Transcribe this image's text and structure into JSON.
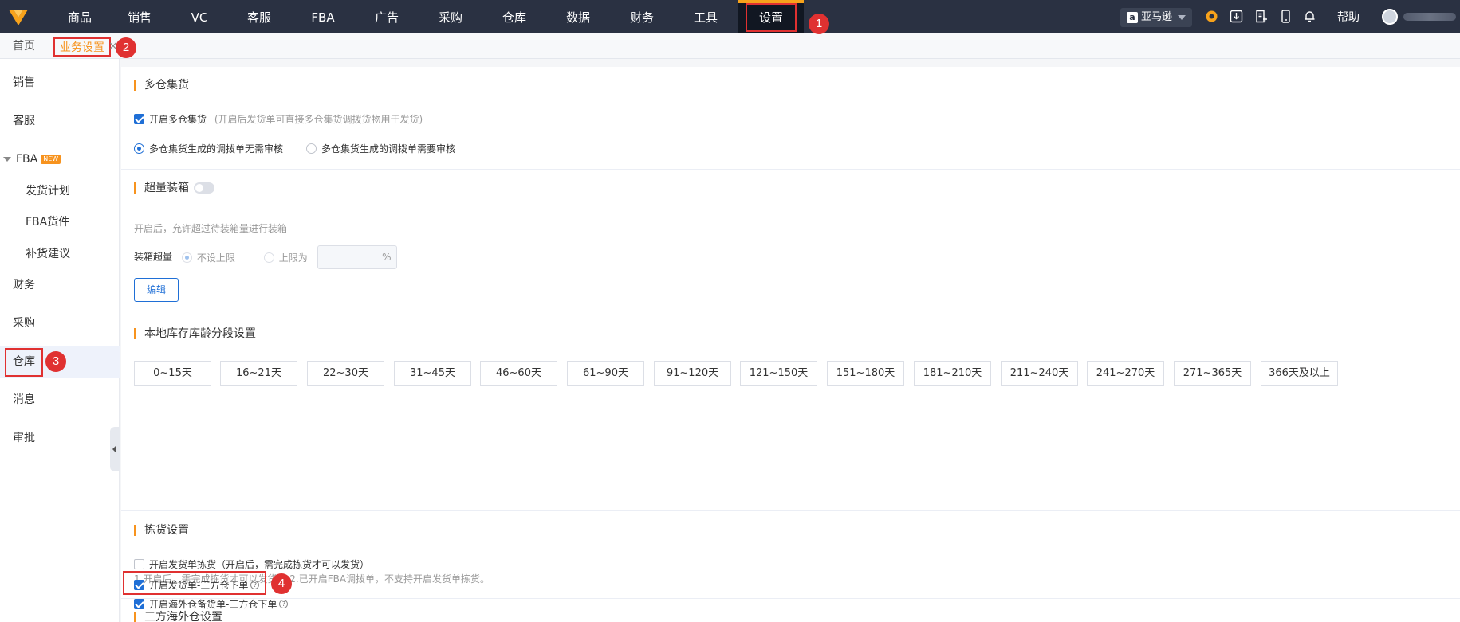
{
  "topnav": {
    "items": [
      "商品",
      "销售",
      "VC",
      "客服",
      "FBA",
      "广告",
      "采购",
      "仓库",
      "数据",
      "财务",
      "工具",
      "设置"
    ],
    "active": "设置",
    "market": "亚马逊",
    "help": "帮助"
  },
  "tabs": {
    "home": "首页",
    "active": "业务设置",
    "close": "×"
  },
  "sidebar": {
    "items": [
      "销售",
      "客服",
      "FBA",
      "发货计划",
      "FBA货件",
      "补货建议",
      "财务",
      "采购",
      "仓库",
      "消息",
      "审批"
    ],
    "new_badge": "NEW",
    "selected": "仓库"
  },
  "sections": {
    "multi_warehouse": {
      "title": "多仓集货",
      "enable_label": "开启多仓集货",
      "enable_hint": "(开启后发货单可直接多仓集货调拨货物用于发货)",
      "enabled": true,
      "radio_no_review": "多仓集货生成的调拨单无需审核",
      "radio_need_review": "多仓集货生成的调拨单需要审核",
      "selected": "no_review"
    },
    "overpack": {
      "title": "超量装箱",
      "toggle_on": false,
      "desc": "开启后，允许超过待装箱量进行装箱",
      "field_label": "装箱超量",
      "opt_unlimited": "不设上限",
      "opt_limit": "上限为",
      "unit": "%",
      "edit_label": "编辑"
    },
    "inventory_age": {
      "title": "本地库存库龄分段设置",
      "ranges": [
        "0~15天",
        "16~21天",
        "22~30天",
        "31~45天",
        "46~60天",
        "61~90天",
        "91~120天",
        "121~150天",
        "151~180天",
        "181~210天",
        "211~240天",
        "241~270天",
        "271~365天",
        "366天及以上"
      ]
    },
    "picking": {
      "title": "拣货设置",
      "enable_label": "开启发货单拣货（开启后，需完成拣货才可以发货）",
      "enabled": false,
      "hint": "1.开启后，需完成拣货才可以发货。 2.已开启FBA调拨单，不支持开启发货单拣货。"
    },
    "third_party": {
      "title": "三方海外仓设置",
      "opt1_label": "开启发货单-三方仓下单",
      "opt1_checked": true,
      "opt2_label": "开启海外仓备货单-三方仓下单",
      "opt2_checked": true,
      "help_glyph": "?"
    }
  },
  "annotations": [
    "1",
    "2",
    "3",
    "4"
  ],
  "colors": {
    "topbar": "#2a3142",
    "accent": "#f7931e",
    "primary": "#1f6fd6",
    "annotation": "#e03131"
  }
}
